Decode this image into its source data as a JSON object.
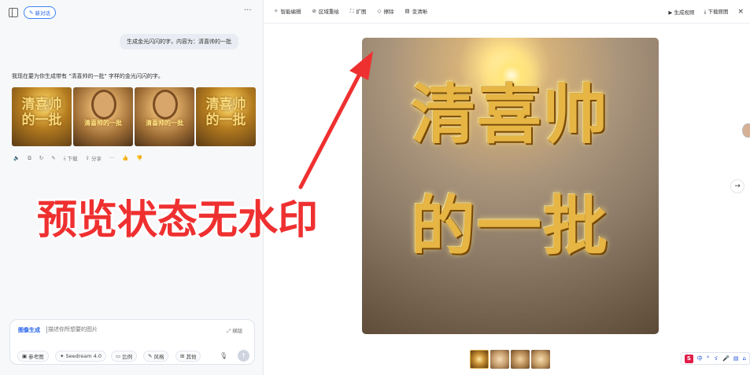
{
  "sidebar_toggle_label": "",
  "new_chat_label": "新对话",
  "more_label": "···",
  "conversation": {
    "user_message": "生成金光闪闪的字，内容为：清喜帅的一批",
    "assistant_reply": "我现在要为你生成带有 \"清喜帅的一批\" 字样的金光闪闪的字。",
    "thumb_texts": [
      "清喜帅\n的一批",
      "清喜帅的一批",
      "清喜帅的一批",
      "清喜帅\n的一批"
    ],
    "actions": {
      "download_label": "下载",
      "share_label": "分享",
      "more_label": "···"
    }
  },
  "composer": {
    "mode_label": "图像生成",
    "placeholder": "描述你所想要的图片",
    "expand_label": "横版",
    "chips": [
      "参考图",
      "Seedream 4.0",
      "比例",
      "风格",
      "其他"
    ],
    "send_label": "↑"
  },
  "toolbar": {
    "items": [
      "智能编辑",
      "区域重绘",
      "扩图",
      "擦除",
      "变清晰"
    ]
  },
  "topright": {
    "generate_video_label": "生成视频",
    "download_original_label": "下载原图",
    "close_label": "×"
  },
  "preview": {
    "text_line1": "清喜帅",
    "text_line2": "的一批"
  },
  "nav": {
    "next_label": "→"
  },
  "overlay": {
    "annotation_text": "预览状态无水印",
    "annotation_color": "#ef3030"
  },
  "ime": {
    "logo": "S",
    "items": [
      "中",
      "°",
      "ゞ",
      "🎤",
      "▤",
      "⌂"
    ]
  },
  "colors": {
    "accent": "#2563eb",
    "annotation": "#ef3030"
  }
}
